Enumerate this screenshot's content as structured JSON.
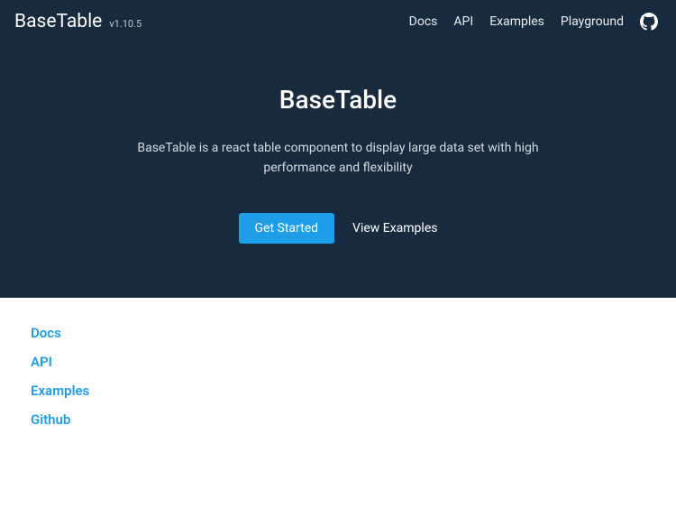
{
  "brand": {
    "title": "BaseTable",
    "version": "v1.10.5"
  },
  "nav": {
    "docs": "Docs",
    "api": "API",
    "examples": "Examples",
    "playground": "Playground"
  },
  "hero": {
    "title": "BaseTable",
    "description": "BaseTable is a react table component to display large data set with high performance and flexibility",
    "get_started": "Get Started",
    "view_examples": "View Examples"
  },
  "links": {
    "docs": "Docs",
    "api": "API",
    "examples": "Examples",
    "github": "Github"
  }
}
